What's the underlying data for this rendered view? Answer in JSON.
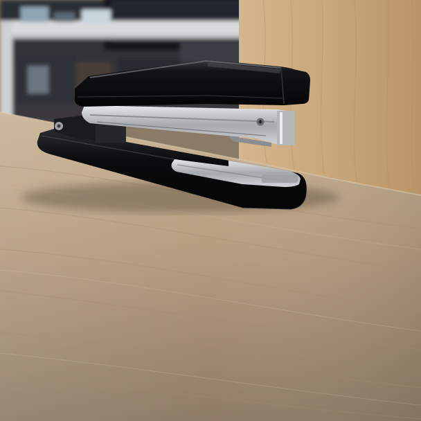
{
  "scene": {
    "subject": "stapler-on-desk",
    "colors": {
      "desk_light": "#c4ad8f",
      "desk_dark": "#8a7660",
      "wall_wood": "#c8a77f",
      "stapler_body": "#0d0d10",
      "metal": "#b9bcc0",
      "background_dark": "#1c1f26",
      "shelf_white": "#d9dadc"
    }
  }
}
